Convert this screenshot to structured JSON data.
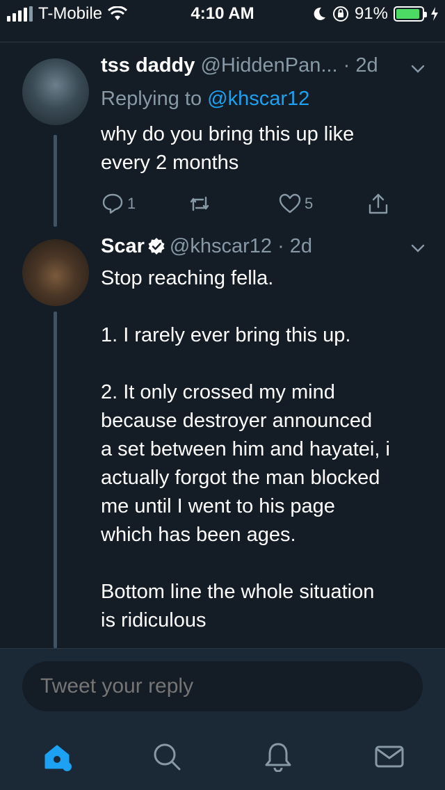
{
  "status_bar": {
    "carrier": "T-Mobile",
    "time": "4:10 AM",
    "battery_percent": "91%",
    "battery_level": 0.91
  },
  "tweets": [
    {
      "name": "tss daddy",
      "handle": "@HiddenPan...",
      "time": "· 2d",
      "replying_prefix": "Replying to ",
      "replying_to": "@khscar12",
      "text": "why do you bring this up like\nevery 2 months",
      "reply_count": "1",
      "like_count": "5"
    },
    {
      "name": "Scar",
      "verified": true,
      "handle": "@khscar12",
      "time": "· 2d",
      "text": "Stop reaching fella.\n\n1. I rarely ever bring this up.\n\n2. It only crossed my mind\nbecause destroyer announced\na set between him and hayatei, i\nactually forgot the man blocked\nme until I went to his page\nwhich has been ages.\n\nBottom line the whole situation\nis ridiculous"
    }
  ],
  "reply_bar": {
    "placeholder": "Tweet your reply"
  },
  "tab_bar": {
    "items": [
      "home-icon",
      "search-icon",
      "notifications-icon",
      "messages-icon"
    ],
    "active": "home-icon"
  },
  "colors": {
    "background": "#141d26",
    "accent": "#1da1f2",
    "muted": "#8899a6",
    "battery": "#4cd964"
  }
}
